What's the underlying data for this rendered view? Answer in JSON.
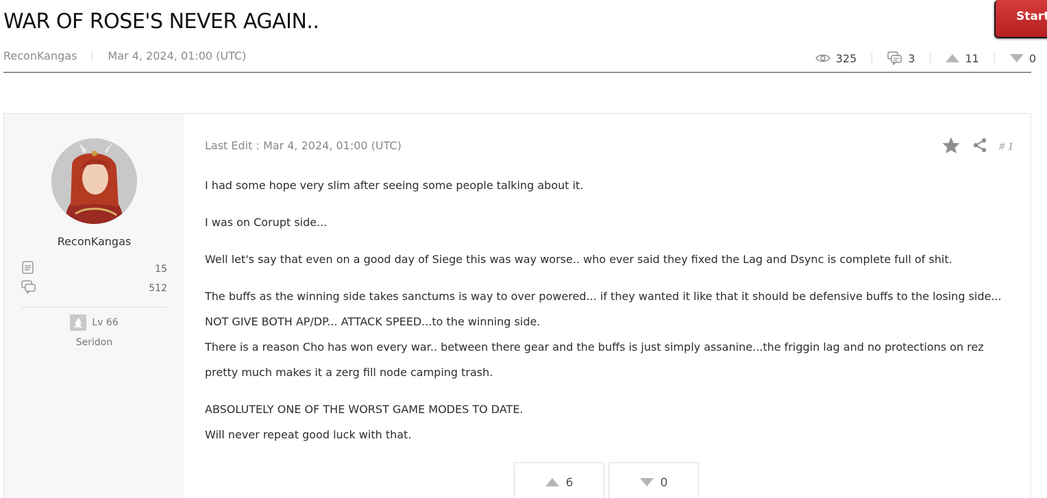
{
  "thread": {
    "title": "WAR OF ROSE'S NEVER AGAIN..",
    "author": "ReconKangas",
    "date": "Mar 4, 2024, 01:00 (UTC)",
    "stats": {
      "views": "325",
      "comments": "3",
      "upvotes": "11",
      "downvotes": "0"
    }
  },
  "start_button": {
    "label": "Start"
  },
  "post": {
    "author": {
      "name": "ReconKangas",
      "posts_count": "15",
      "comments_count": "512",
      "level": "Lv 66",
      "server": "Seridon"
    },
    "last_edit": "Last Edit : Mar 4, 2024, 01:00 (UTC)",
    "number": "# 1",
    "body": {
      "p1": "I had some hope very slim after seeing some people talking about it.",
      "p2": "I was on Corupt side...",
      "p3": "Well let's say that even on a good day of Siege this was way worse.. who ever said they fixed the Lag and Dsync is complete full of shit.",
      "p4a": "The buffs as the winning side takes sanctums is way to over powered... if they wanted it like that it should be defensive buffs to the losing side... NOT GIVE BOTH AP/DP... ATTACK SPEED...to the winning side.",
      "p4b": "There is a reason Cho has won every war.. between there gear and the buffs is just simply assanine...the friggin lag and no protections on rez pretty much makes it a zerg fill node camping trash.",
      "p5a": "ABSOLUTELY ONE OF THE WORST GAME MODES TO DATE.",
      "p5b": "Will never repeat good luck with that."
    },
    "votes": {
      "up": "6",
      "down": "0"
    }
  },
  "colors": {
    "start_button": "#c62d2d",
    "title_rule": "#3a3a3a",
    "author_panel": "#f7f7f7",
    "muted_text": "#888888"
  },
  "icons": [
    "eye-icon",
    "comments-icon",
    "upvote-icon",
    "downvote-icon",
    "star-icon",
    "share-icon",
    "posts-icon",
    "level-badge-icon"
  ]
}
